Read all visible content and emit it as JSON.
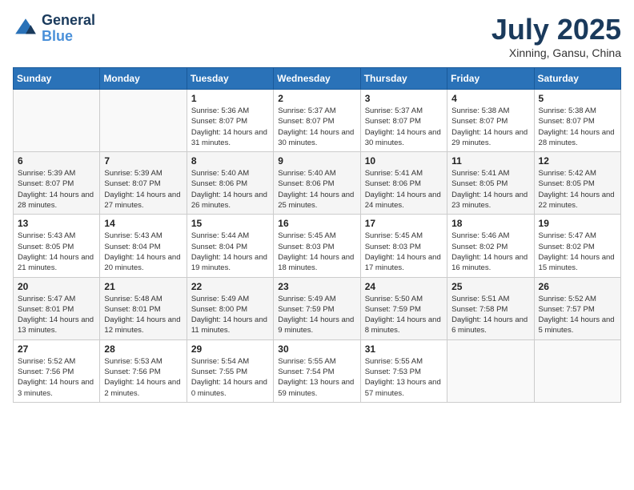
{
  "header": {
    "logo_line1": "General",
    "logo_line2": "Blue",
    "month_title": "July 2025",
    "location": "Xinning, Gansu, China"
  },
  "weekdays": [
    "Sunday",
    "Monday",
    "Tuesday",
    "Wednesday",
    "Thursday",
    "Friday",
    "Saturday"
  ],
  "weeks": [
    [
      {
        "day": "",
        "info": ""
      },
      {
        "day": "",
        "info": ""
      },
      {
        "day": "1",
        "info": "Sunrise: 5:36 AM\nSunset: 8:07 PM\nDaylight: 14 hours and 31 minutes."
      },
      {
        "day": "2",
        "info": "Sunrise: 5:37 AM\nSunset: 8:07 PM\nDaylight: 14 hours and 30 minutes."
      },
      {
        "day": "3",
        "info": "Sunrise: 5:37 AM\nSunset: 8:07 PM\nDaylight: 14 hours and 30 minutes."
      },
      {
        "day": "4",
        "info": "Sunrise: 5:38 AM\nSunset: 8:07 PM\nDaylight: 14 hours and 29 minutes."
      },
      {
        "day": "5",
        "info": "Sunrise: 5:38 AM\nSunset: 8:07 PM\nDaylight: 14 hours and 28 minutes."
      }
    ],
    [
      {
        "day": "6",
        "info": "Sunrise: 5:39 AM\nSunset: 8:07 PM\nDaylight: 14 hours and 28 minutes."
      },
      {
        "day": "7",
        "info": "Sunrise: 5:39 AM\nSunset: 8:07 PM\nDaylight: 14 hours and 27 minutes."
      },
      {
        "day": "8",
        "info": "Sunrise: 5:40 AM\nSunset: 8:06 PM\nDaylight: 14 hours and 26 minutes."
      },
      {
        "day": "9",
        "info": "Sunrise: 5:40 AM\nSunset: 8:06 PM\nDaylight: 14 hours and 25 minutes."
      },
      {
        "day": "10",
        "info": "Sunrise: 5:41 AM\nSunset: 8:06 PM\nDaylight: 14 hours and 24 minutes."
      },
      {
        "day": "11",
        "info": "Sunrise: 5:41 AM\nSunset: 8:05 PM\nDaylight: 14 hours and 23 minutes."
      },
      {
        "day": "12",
        "info": "Sunrise: 5:42 AM\nSunset: 8:05 PM\nDaylight: 14 hours and 22 minutes."
      }
    ],
    [
      {
        "day": "13",
        "info": "Sunrise: 5:43 AM\nSunset: 8:05 PM\nDaylight: 14 hours and 21 minutes."
      },
      {
        "day": "14",
        "info": "Sunrise: 5:43 AM\nSunset: 8:04 PM\nDaylight: 14 hours and 20 minutes."
      },
      {
        "day": "15",
        "info": "Sunrise: 5:44 AM\nSunset: 8:04 PM\nDaylight: 14 hours and 19 minutes."
      },
      {
        "day": "16",
        "info": "Sunrise: 5:45 AM\nSunset: 8:03 PM\nDaylight: 14 hours and 18 minutes."
      },
      {
        "day": "17",
        "info": "Sunrise: 5:45 AM\nSunset: 8:03 PM\nDaylight: 14 hours and 17 minutes."
      },
      {
        "day": "18",
        "info": "Sunrise: 5:46 AM\nSunset: 8:02 PM\nDaylight: 14 hours and 16 minutes."
      },
      {
        "day": "19",
        "info": "Sunrise: 5:47 AM\nSunset: 8:02 PM\nDaylight: 14 hours and 15 minutes."
      }
    ],
    [
      {
        "day": "20",
        "info": "Sunrise: 5:47 AM\nSunset: 8:01 PM\nDaylight: 14 hours and 13 minutes."
      },
      {
        "day": "21",
        "info": "Sunrise: 5:48 AM\nSunset: 8:01 PM\nDaylight: 14 hours and 12 minutes."
      },
      {
        "day": "22",
        "info": "Sunrise: 5:49 AM\nSunset: 8:00 PM\nDaylight: 14 hours and 11 minutes."
      },
      {
        "day": "23",
        "info": "Sunrise: 5:49 AM\nSunset: 7:59 PM\nDaylight: 14 hours and 9 minutes."
      },
      {
        "day": "24",
        "info": "Sunrise: 5:50 AM\nSunset: 7:59 PM\nDaylight: 14 hours and 8 minutes."
      },
      {
        "day": "25",
        "info": "Sunrise: 5:51 AM\nSunset: 7:58 PM\nDaylight: 14 hours and 6 minutes."
      },
      {
        "day": "26",
        "info": "Sunrise: 5:52 AM\nSunset: 7:57 PM\nDaylight: 14 hours and 5 minutes."
      }
    ],
    [
      {
        "day": "27",
        "info": "Sunrise: 5:52 AM\nSunset: 7:56 PM\nDaylight: 14 hours and 3 minutes."
      },
      {
        "day": "28",
        "info": "Sunrise: 5:53 AM\nSunset: 7:56 PM\nDaylight: 14 hours and 2 minutes."
      },
      {
        "day": "29",
        "info": "Sunrise: 5:54 AM\nSunset: 7:55 PM\nDaylight: 14 hours and 0 minutes."
      },
      {
        "day": "30",
        "info": "Sunrise: 5:55 AM\nSunset: 7:54 PM\nDaylight: 13 hours and 59 minutes."
      },
      {
        "day": "31",
        "info": "Sunrise: 5:55 AM\nSunset: 7:53 PM\nDaylight: 13 hours and 57 minutes."
      },
      {
        "day": "",
        "info": ""
      },
      {
        "day": "",
        "info": ""
      }
    ]
  ]
}
